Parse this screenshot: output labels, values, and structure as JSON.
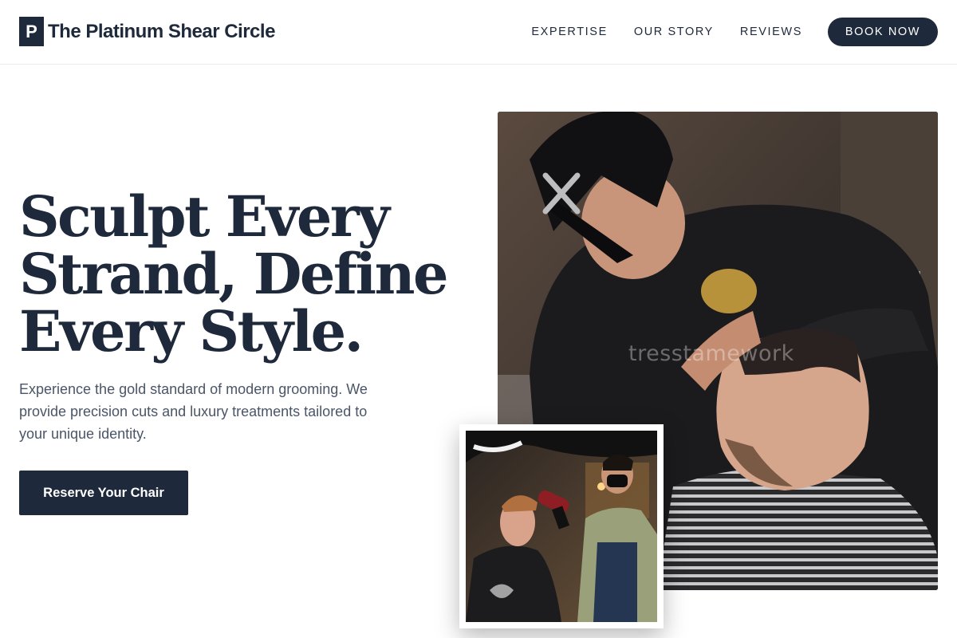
{
  "header": {
    "brand_mark": "P",
    "brand_name": "The Platinum Shear Circle",
    "nav": {
      "expertise": "EXPERTISE",
      "our_story": "OUR STORY",
      "reviews": "REVIEWS",
      "book_now": "BOOK NOW"
    }
  },
  "hero": {
    "title": "Sculpt Every Strand, Define Every Style.",
    "description": "Experience the gold standard of modern grooming. We provide precision cuts and luxury treatments tailored to your unique identity.",
    "cta_label": "Reserve Your Chair"
  },
  "main_image": {
    "watermark": "tresstamework"
  },
  "colors": {
    "primary": "#1e293b",
    "body_text": "#4a5568",
    "background": "#ffffff"
  }
}
